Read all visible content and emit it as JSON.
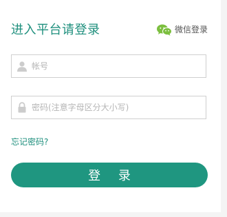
{
  "header": {
    "title": "进入平台请登录",
    "wechat_label": "微信登录"
  },
  "form": {
    "account_placeholder": "帐号",
    "account_value": "",
    "password_placeholder": "密码(注意字母区分大小写)",
    "password_value": ""
  },
  "links": {
    "forgot_password": "忘记密码?"
  },
  "actions": {
    "login_label": "登 录"
  },
  "icons": {
    "wechat": "wechat-icon",
    "user": "user-icon",
    "lock": "lock-icon"
  },
  "colors": {
    "brand": "#1f9680",
    "brand_text": "#1e8f7d",
    "wechat_green": "#7cbf3f",
    "icon_gray": "#cccccc",
    "border": "#cfcfcf"
  }
}
